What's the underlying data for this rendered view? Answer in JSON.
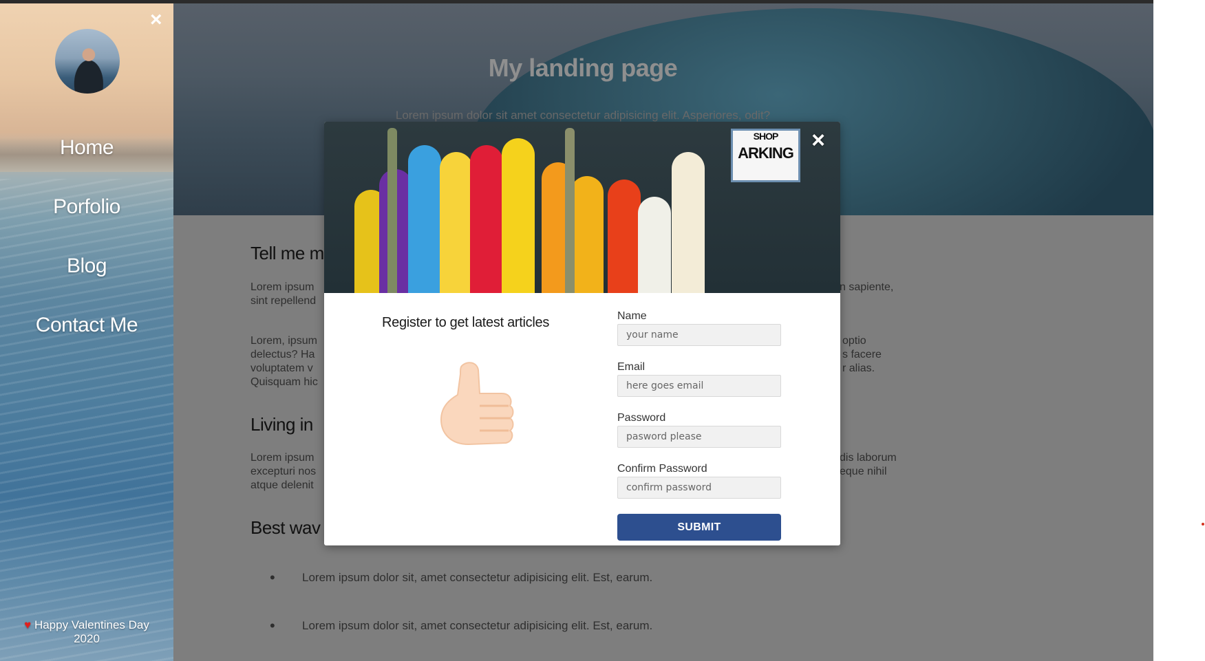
{
  "sidebar": {
    "close_icon": "×",
    "nav": [
      "Home",
      "Porfolio",
      "Blog",
      "Contact Me"
    ],
    "footer_heart": "♥",
    "footer_text": "Happy Valentines Day",
    "footer_year": "2020"
  },
  "hero": {
    "title": "My landing page",
    "subtitle": "Lorem ipsum dolor sit amet consectetur adipisicing elit. Asperiores, odit?"
  },
  "content": {
    "section1_title": "Tell me m",
    "p1_left": [
      "Lorem ipsum",
      "sint repellend"
    ],
    "p1_right": "n sapiente,",
    "p2_left": [
      "Lorem, ipsum",
      "delectus? Ha",
      "voluptatem v",
      "Quisquam hic"
    ],
    "p2_right": [
      "optio",
      "s facere",
      "r alias."
    ],
    "section2_title": "Living in",
    "p3_left": [
      "Lorem ipsum",
      "excepturi nos",
      "atque delenit"
    ],
    "p3_right": [
      "dis laborum",
      "eque nihil"
    ],
    "section3_title": "Best wav",
    "bullets": [
      "Lorem ipsum dolor sit, amet consectetur adipisicing elit. Est, earum.",
      "Lorem ipsum dolor sit, amet consectetur adipisicing elit. Est, earum."
    ],
    "bullet_dot": "•"
  },
  "modal": {
    "close_icon": "×",
    "sign_text": "ARKING",
    "sign_top": "SHOP",
    "heading": "Register to get latest articles",
    "fields": [
      {
        "label": "Name",
        "placeholder": "your name"
      },
      {
        "label": "Email",
        "placeholder": "here goes email"
      },
      {
        "label": "Password",
        "placeholder": "pasword please"
      },
      {
        "label": "Confirm Password",
        "placeholder": "confirm password"
      }
    ],
    "submit": "SUBMIT"
  },
  "icons": [
    "close-icon",
    "heart-icon",
    "thumbs-up-icon",
    "avatar"
  ],
  "colors": {
    "submit": "#2d4f8f",
    "heart": "#e0201e",
    "overlay": "#7e7e7e"
  }
}
